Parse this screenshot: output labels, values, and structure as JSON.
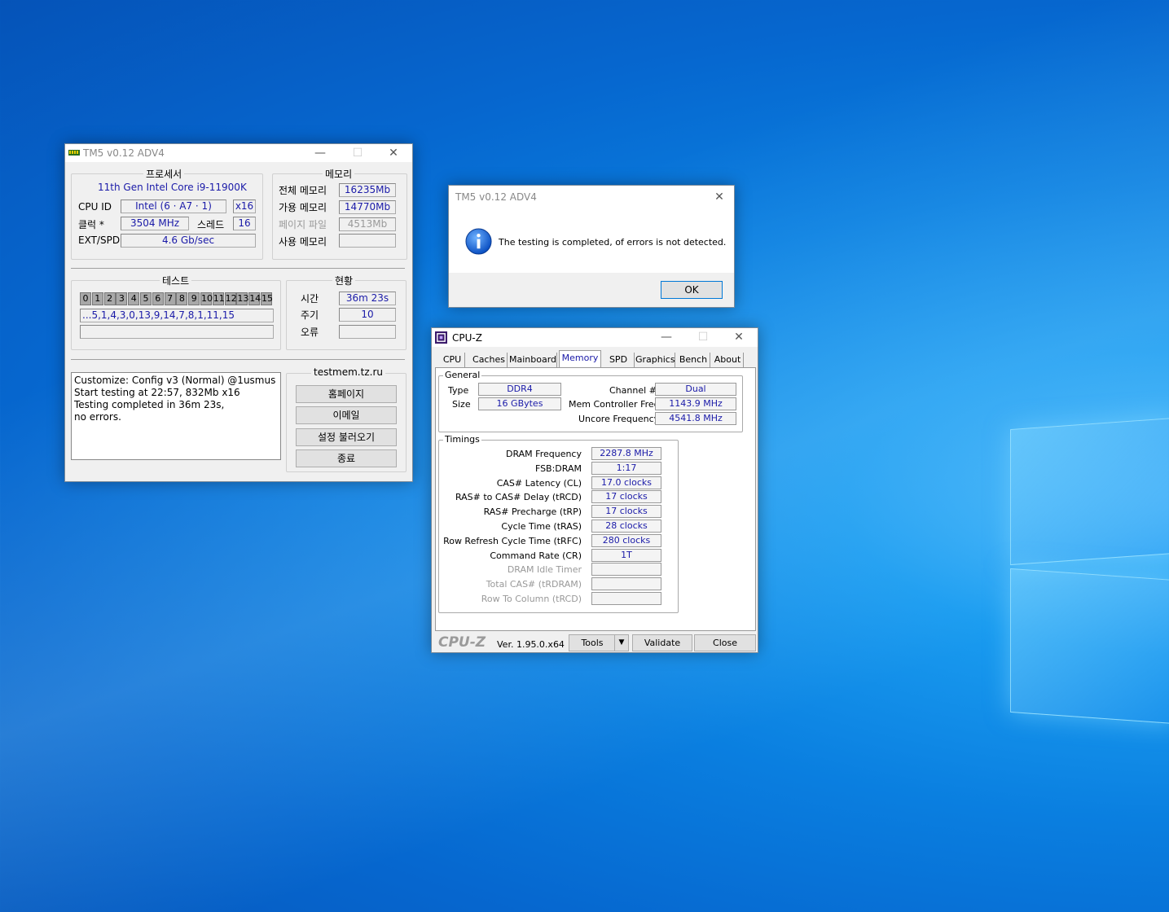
{
  "tm5": {
    "title": "TM5 v0.12 ADV4",
    "processor_group": "프로세서",
    "memory_group": "메모리",
    "cpu_name": "11th Gen Intel Core i9-11900K",
    "cpu_id_label": "CPU ID",
    "cpu_id_value": "Intel  (6 · A7 · 1)",
    "cpu_id_threads": "x16",
    "clock_label": "클럭 *",
    "clock_value": "3504 MHz",
    "thread_label": "스레드",
    "thread_value": "16",
    "ext_label": "EXT/SPD",
    "ext_value": "4.6 Gb/sec",
    "total_mem_label": "전체 메모리",
    "total_mem_value": "16235Mb",
    "avail_mem_label": "가용 메모리",
    "avail_mem_value": "14770Mb",
    "page_file_label": "페이지 파일",
    "page_file_value": "4513Mb",
    "used_mem_label": "사용 메모리",
    "used_mem_value": "",
    "test_group": "테스트",
    "status_group": "현황",
    "test_numbers": [
      "0",
      "1",
      "2",
      "3",
      "4",
      "5",
      "6",
      "7",
      "8",
      "9",
      "10",
      "11",
      "12",
      "13",
      "14",
      "15"
    ],
    "test_sequence": "...5,1,4,3,0,13,9,14,7,8,1,11,15",
    "time_label": "시간",
    "time_value": "36m 23s",
    "cycle_label": "주기",
    "cycle_value": "10",
    "error_label": "오류",
    "error_value": "",
    "log_lines": [
      "Customize: Config v3 (Normal) @1usmus",
      "Start testing at 22:57, 832Mb x16",
      "Testing completed in 36m 23s,",
      "no errors."
    ],
    "site": "testmem.tz.ru",
    "btn_home": "홈페이지",
    "btn_email": "이메일",
    "btn_load": "설정 불러오기",
    "btn_exit": "종료"
  },
  "dialog": {
    "title": "TM5 v0.12 ADV4",
    "message": "The testing is completed, of errors is not detected.",
    "ok": "OK"
  },
  "cpuz": {
    "title": "CPU-Z",
    "tabs": [
      "CPU",
      "Caches",
      "Mainboard",
      "Memory",
      "SPD",
      "Graphics",
      "Bench",
      "About"
    ],
    "active_tab": "Memory",
    "general_label": "General",
    "type_label": "Type",
    "type_value": "DDR4",
    "size_label": "Size",
    "size_value": "16 GBytes",
    "channel_label": "Channel #",
    "channel_value": "Dual",
    "memctrl_label": "Mem Controller Freq.",
    "memctrl_value": "1143.9 MHz",
    "uncore_label": "Uncore Frequency",
    "uncore_value": "4541.8 MHz",
    "timings_label": "Timings",
    "timings": [
      {
        "label": "DRAM Frequency",
        "value": "2287.8 MHz",
        "dim": false
      },
      {
        "label": "FSB:DRAM",
        "value": "1:17",
        "dim": false
      },
      {
        "label": "CAS# Latency (CL)",
        "value": "17.0 clocks",
        "dim": false
      },
      {
        "label": "RAS# to CAS# Delay (tRCD)",
        "value": "17 clocks",
        "dim": false
      },
      {
        "label": "RAS# Precharge (tRP)",
        "value": "17 clocks",
        "dim": false
      },
      {
        "label": "Cycle Time (tRAS)",
        "value": "28 clocks",
        "dim": false
      },
      {
        "label": "Row Refresh Cycle Time (tRFC)",
        "value": "280 clocks",
        "dim": false
      },
      {
        "label": "Command Rate (CR)",
        "value": "1T",
        "dim": false
      },
      {
        "label": "DRAM Idle Timer",
        "value": "",
        "dim": true
      },
      {
        "label": "Total CAS# (tRDRAM)",
        "value": "",
        "dim": true
      },
      {
        "label": "Row To Column (tRCD)",
        "value": "",
        "dim": true
      }
    ],
    "brand": "CPU-Z",
    "version": "Ver. 1.95.0.x64",
    "btn_tools": "Tools",
    "btn_validate": "Validate",
    "btn_close": "Close"
  }
}
